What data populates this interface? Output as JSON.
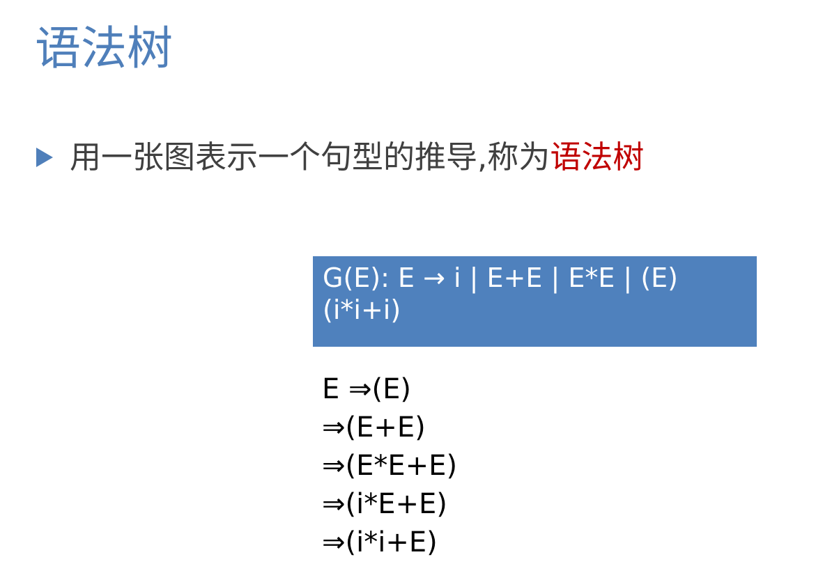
{
  "slide": {
    "title": "语法树",
    "bullet": {
      "text": "用一张图表示一个句型的推导,称为",
      "highlight": "语法树",
      "icon": "triangle-right-icon"
    }
  },
  "grammar": {
    "line1": "G(E):   E → i | E+E | E*E | (E)",
    "line2": "(i*i+i)"
  },
  "derivation": [
    "E ⇒(E)",
    "⇒(E+E)",
    "⇒(E*E+E)",
    "⇒(i*E+E)",
    "⇒(i*i+E)"
  ],
  "colors": {
    "title": "#4f7fba",
    "highlight": "#c00000",
    "box_background": "#4f81bd",
    "body_text": "#404040"
  }
}
